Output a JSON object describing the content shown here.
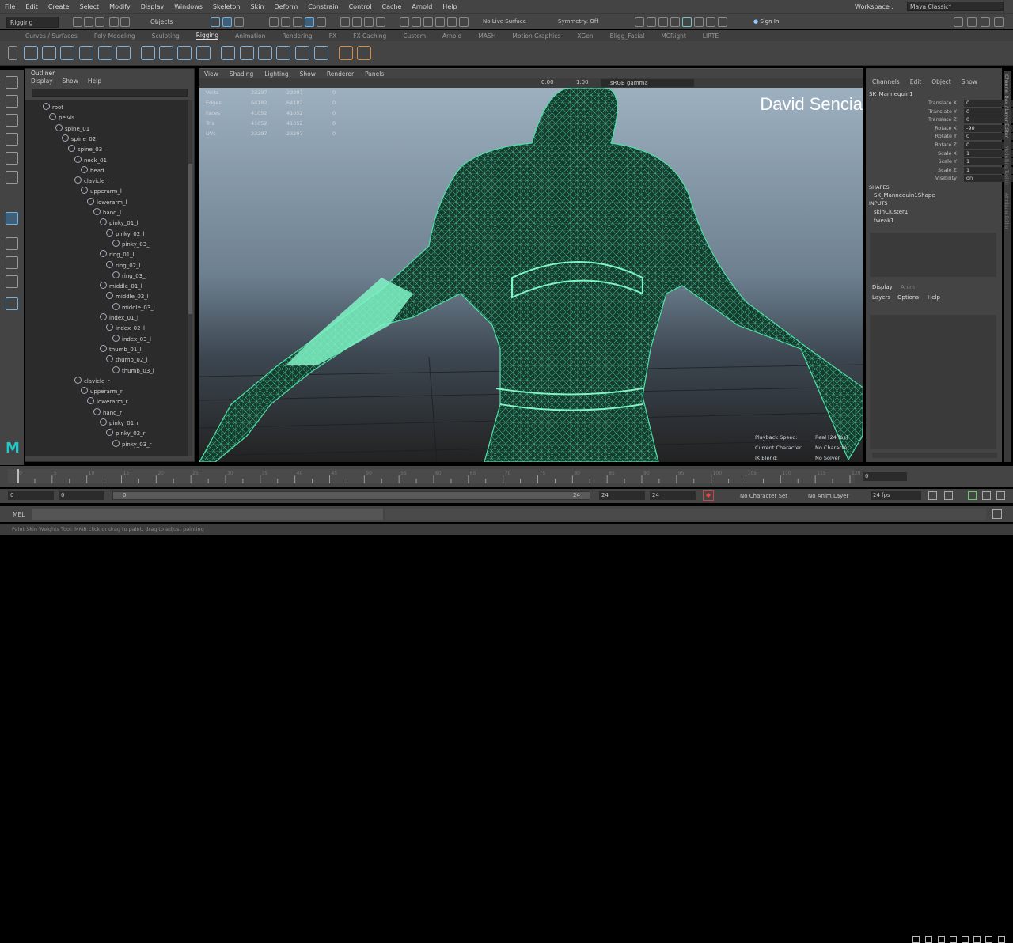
{
  "menubar": {
    "items": [
      "File",
      "Edit",
      "Create",
      "Select",
      "Modify",
      "Display",
      "Windows",
      "Skeleton",
      "Skin",
      "Deform",
      "Constrain",
      "Control",
      "Cache",
      "Arnold",
      "Help"
    ],
    "workspace_label": "Workspace :",
    "workspace_value": "Maya Classic*"
  },
  "statusline": {
    "mode": "Rigging",
    "objects": "Objects",
    "live_surface": "No Live Surface",
    "symmetry": "Symmetry: Off",
    "sign_in": "Sign In"
  },
  "shelf_tabs": [
    "Curves / Surfaces",
    "Poly Modeling",
    "Sculpting",
    "Rigging",
    "Animation",
    "Rendering",
    "FX",
    "FX Caching",
    "Custom",
    "Arnold",
    "MASH",
    "Motion Graphics",
    "XGen",
    "Bligg_Facial",
    "MCRight",
    "LIRTE"
  ],
  "shelf_active_index": 3,
  "outliner": {
    "title": "Outliner",
    "menu": [
      "Display",
      "Show",
      "Help"
    ],
    "nodes": [
      {
        "name": "root",
        "depth": 0
      },
      {
        "name": "pelvis",
        "depth": 1
      },
      {
        "name": "spine_01",
        "depth": 2
      },
      {
        "name": "spine_02",
        "depth": 3
      },
      {
        "name": "spine_03",
        "depth": 4
      },
      {
        "name": "neck_01",
        "depth": 5
      },
      {
        "name": "head",
        "depth": 6
      },
      {
        "name": "clavicle_l",
        "depth": 5
      },
      {
        "name": "upperarm_l",
        "depth": 6
      },
      {
        "name": "lowerarm_l",
        "depth": 7
      },
      {
        "name": "hand_l",
        "depth": 8
      },
      {
        "name": "pinky_01_l",
        "depth": 9
      },
      {
        "name": "pinky_02_l",
        "depth": 10
      },
      {
        "name": "pinky_03_l",
        "depth": 11
      },
      {
        "name": "ring_01_l",
        "depth": 9
      },
      {
        "name": "ring_02_l",
        "depth": 10
      },
      {
        "name": "ring_03_l",
        "depth": 11
      },
      {
        "name": "middle_01_l",
        "depth": 9
      },
      {
        "name": "middle_02_l",
        "depth": 10
      },
      {
        "name": "middle_03_l",
        "depth": 11
      },
      {
        "name": "index_01_l",
        "depth": 9
      },
      {
        "name": "index_02_l",
        "depth": 10
      },
      {
        "name": "index_03_l",
        "depth": 11
      },
      {
        "name": "thumb_01_l",
        "depth": 9
      },
      {
        "name": "thumb_02_l",
        "depth": 10
      },
      {
        "name": "thumb_03_l",
        "depth": 11
      },
      {
        "name": "clavicle_r",
        "depth": 5
      },
      {
        "name": "upperarm_r",
        "depth": 6
      },
      {
        "name": "lowerarm_r",
        "depth": 7
      },
      {
        "name": "hand_r",
        "depth": 8
      },
      {
        "name": "pinky_01_r",
        "depth": 9
      },
      {
        "name": "pinky_02_r",
        "depth": 10
      },
      {
        "name": "pinky_03_r",
        "depth": 11
      }
    ]
  },
  "viewport": {
    "menu": [
      "View",
      "Shading",
      "Lighting",
      "Show",
      "Renderer",
      "Panels"
    ],
    "exposure": "0.00",
    "gamma": "1.00",
    "color_space": "sRGB gamma",
    "hud_stats": [
      {
        "label": "Verts",
        "a": "23297",
        "b": "23297",
        "c": "0"
      },
      {
        "label": "Edges",
        "a": "64182",
        "b": "64182",
        "c": "0"
      },
      {
        "label": "Faces",
        "a": "41052",
        "b": "41052",
        "c": "0"
      },
      {
        "label": "Tris",
        "a": "41052",
        "b": "41052",
        "c": "0"
      },
      {
        "label": "UVs",
        "a": "23297",
        "b": "23297",
        "c": "0"
      }
    ],
    "watermark": "David Sencia",
    "hud_bottom": [
      {
        "label": "Playback Speed:",
        "value": "Real [24 fps]"
      },
      {
        "label": "Current Character:",
        "value": "No Character"
      },
      {
        "label": "IK Blend:",
        "value": "No Solver"
      }
    ]
  },
  "channelbox": {
    "menu": [
      "Channels",
      "Edit",
      "Object",
      "Show"
    ],
    "object": "SK_Mannequin1",
    "attributes": [
      {
        "label": "Translate X",
        "value": "0"
      },
      {
        "label": "Translate Y",
        "value": "0"
      },
      {
        "label": "Translate Z",
        "value": "0"
      },
      {
        "label": "Rotate X",
        "value": "-90"
      },
      {
        "label": "Rotate Y",
        "value": "0"
      },
      {
        "label": "Rotate Z",
        "value": "0"
      },
      {
        "label": "Scale X",
        "value": "1"
      },
      {
        "label": "Scale Y",
        "value": "1"
      },
      {
        "label": "Scale Z",
        "value": "1"
      },
      {
        "label": "Visibility",
        "value": "on"
      }
    ],
    "shapes_header": "SHAPES",
    "shape": "SK_Mannequin1Shape",
    "inputs_header": "INPUTS",
    "inputs": [
      "skinCluster1",
      "tweak1"
    ],
    "layer_tabs": [
      "Display",
      "Anim"
    ],
    "layer_menu": [
      "Layers",
      "Options",
      "Help"
    ]
  },
  "side_tabs": [
    "Channel Box / Layer Editor",
    "Modelling Toolkit",
    "Attribute Editor"
  ],
  "timeslider": {
    "ticks": [
      "0",
      "",
      "5",
      "",
      "10",
      "",
      "15",
      "",
      "20",
      "",
      "25",
      "",
      "30",
      "",
      "35",
      "",
      "40",
      "",
      "45",
      "",
      "50",
      "",
      "55",
      "",
      "60",
      "",
      "65",
      "",
      "70",
      "",
      "75",
      "",
      "80",
      "",
      "85",
      "",
      "90",
      "",
      "95",
      "",
      "100",
      "",
      "105",
      "",
      "110",
      "",
      "115",
      "",
      "120"
    ],
    "current_frame": "0"
  },
  "range": {
    "start": "0",
    "start_inner": "0",
    "range_start_label": "0",
    "range_end_label": "24",
    "end_inner": "24",
    "end": "24",
    "character_set": "No Character Set",
    "anim_layer": "No Anim Layer",
    "fps": "24 fps"
  },
  "mel": {
    "label": "MEL"
  },
  "helpline": "Paint Skin Weights Tool: MMB click or drag to paint; drag to adjust painting"
}
